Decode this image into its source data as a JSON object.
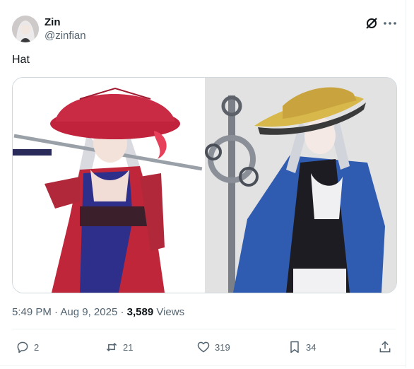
{
  "author": {
    "display_name": "Zin",
    "handle": "@zinfian"
  },
  "header_icons": [
    "grok-icon",
    "more-icon"
  ],
  "tweet": {
    "text": "Hat"
  },
  "media": {
    "count": 2
  },
  "meta": {
    "time": "5:49 PM",
    "separator": "·",
    "date": "Aug 9, 2025",
    "views_count": "3,589",
    "views_label": "Views"
  },
  "actions": {
    "replies": "2",
    "reposts": "21",
    "likes": "319",
    "bookmarks": "34"
  },
  "colors": {
    "text_primary": "#0f1419",
    "text_secondary": "#536471",
    "border": "#cfd9de"
  }
}
